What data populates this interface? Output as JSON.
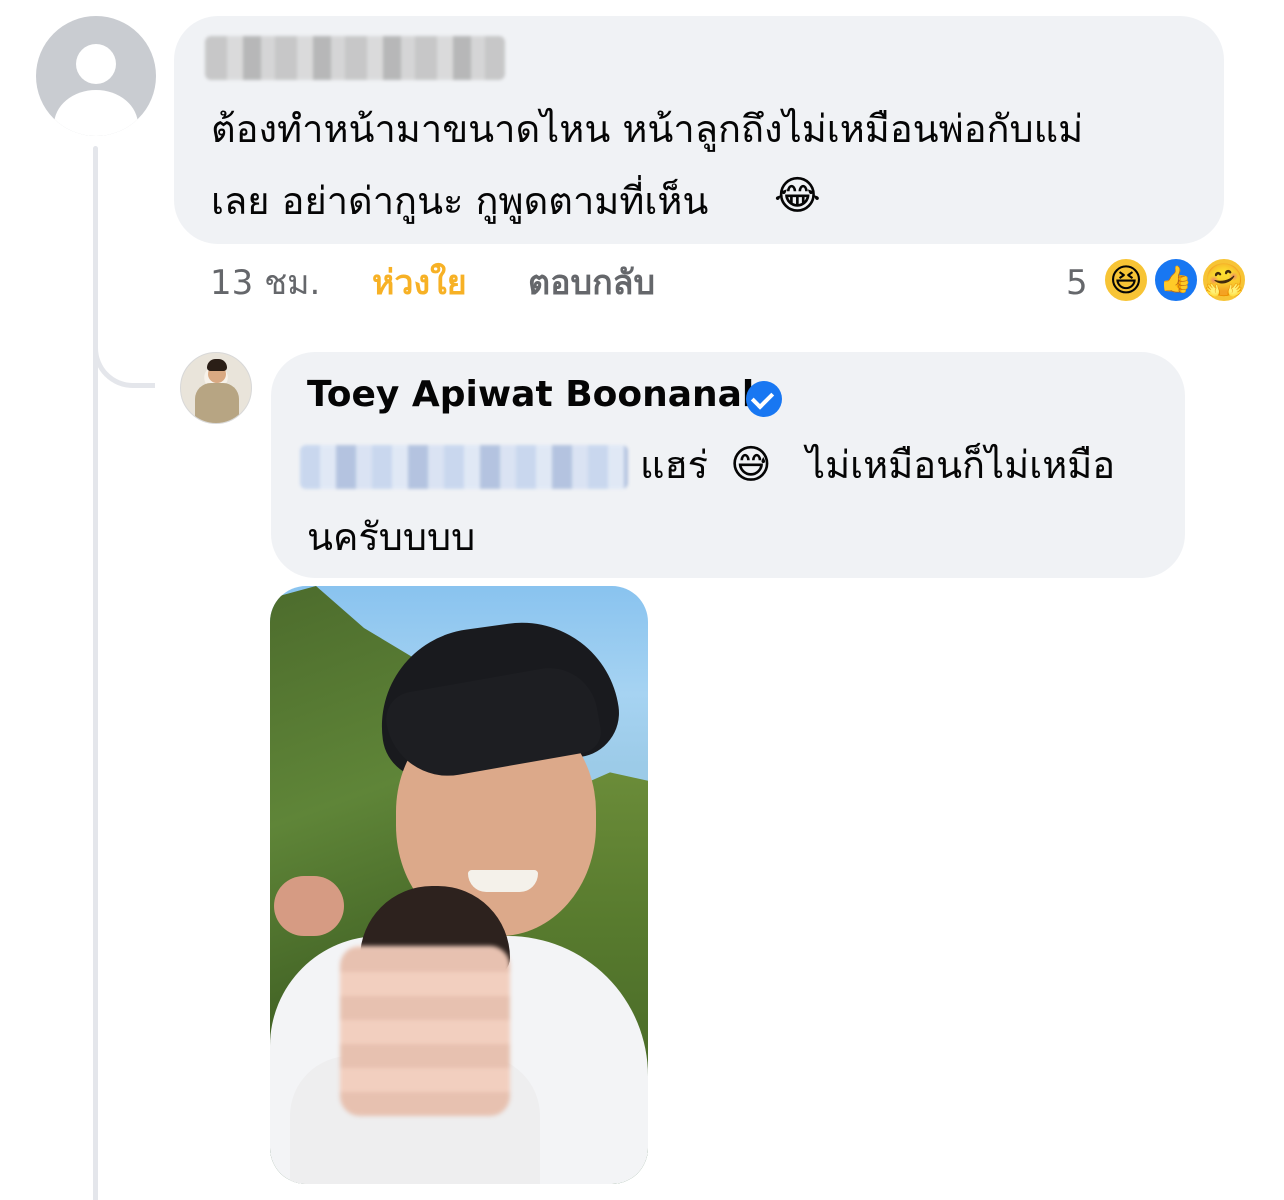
{
  "comment1": {
    "text_line1": "ต้องทำหน้ามาขนาดไหน หน้าลูกถึงไม่เหมือนพ่อกับแม่",
    "text_line2": "เลย อย่าด่ากูนะ กูพูดตามที่เห็น",
    "emoji": "😂",
    "time": "13 ชม.",
    "reaction_label": "ห่วงใย",
    "reply_label": "ตอบกลับ",
    "reaction_count": "5",
    "reaction_icons": [
      "haha-icon",
      "like-icon",
      "care-icon"
    ]
  },
  "reply1": {
    "author": "Toey Apiwat Boonanak",
    "share_text": "แฮร่",
    "emoji": "😅",
    "text_rest": "ไม่เหมือนก็ไม่เหมือ",
    "text_line2": "นครับบบบ",
    "verified": true
  },
  "colors": {
    "bubble": "#f0f2f5",
    "care_reaction": "#f7b125",
    "meta_text": "#65676b",
    "verified_badge": "#1877f2"
  }
}
